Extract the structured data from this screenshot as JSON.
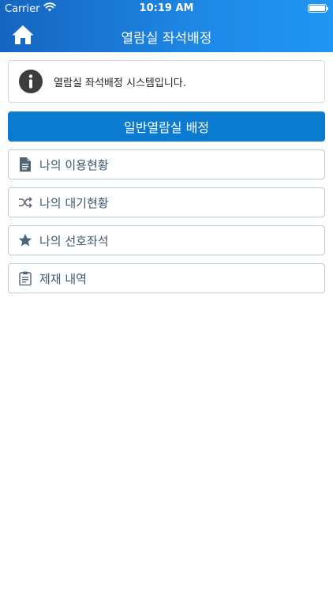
{
  "status_bar": {
    "carrier": "Carrier",
    "time": "10:19 AM",
    "battery_level": 1.0
  },
  "nav": {
    "title": "열람실 좌석배정",
    "home_icon": "home-icon"
  },
  "info": {
    "icon": "info-icon",
    "text": "열람실 좌석배정 시스템입니다."
  },
  "primary_button": {
    "label": "일반열람실 배정"
  },
  "menu": [
    {
      "icon": "document-icon",
      "label": "나의 이용현황"
    },
    {
      "icon": "shuffle-icon",
      "label": "나의 대기현황"
    },
    {
      "icon": "star-icon",
      "label": "나의 선호좌석"
    },
    {
      "icon": "clipboard-icon",
      "label": "제재 내역"
    }
  ],
  "colors": {
    "nav_gradient_start": "#1565c0",
    "nav_gradient_end": "#2196f3",
    "primary_button": "#0b7ad1",
    "menu_text": "#3f5568",
    "menu_icon": "#4f6476"
  }
}
